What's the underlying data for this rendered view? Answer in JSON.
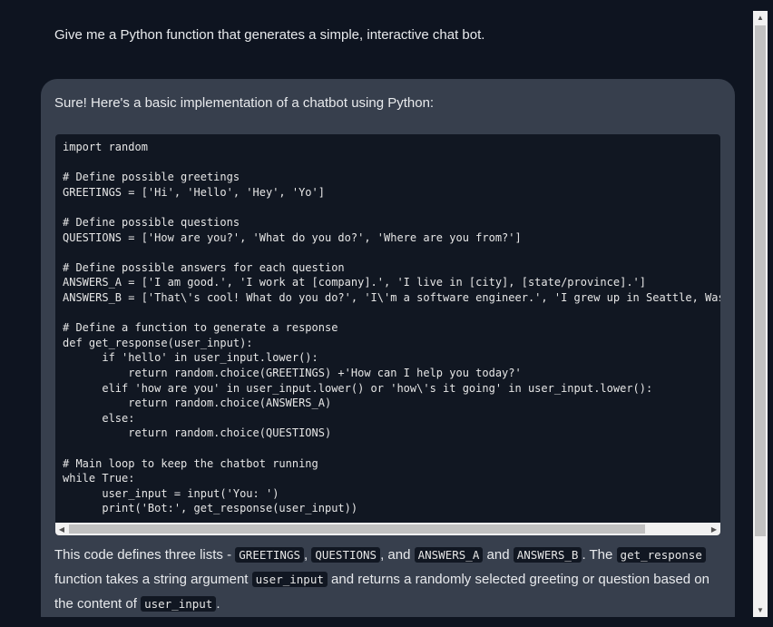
{
  "conversation": {
    "user_message": "Give me a Python function that generates a simple, interactive chat bot.",
    "assistant": {
      "intro": "Sure! Here's a basic implementation of a chatbot using Python:",
      "code_lines": [
        "import random",
        "",
        "# Define possible greetings",
        "GREETINGS = ['Hi', 'Hello', 'Hey', 'Yo']",
        "",
        "# Define possible questions",
        "QUESTIONS = ['How are you?', 'What do you do?', 'Where are you from?']",
        "",
        "# Define possible answers for each question",
        "ANSWERS_A = ['I am good.', 'I work at [company].', 'I live in [city], [state/province].']",
        "ANSWERS_B = ['That\\'s cool! What do you do?', 'I\\'m a software engineer.', 'I grew up in Seattle, Wash",
        "",
        "# Define a function to generate a response",
        "def get_response(user_input):",
        "      if 'hello' in user_input.lower():",
        "          return random.choice(GREETINGS) +'How can I help you today?'",
        "      elif 'how are you' in user_input.lower() or 'how\\'s it going' in user_input.lower():",
        "          return random.choice(ANSWERS_A)",
        "      else:",
        "          return random.choice(QUESTIONS)",
        "",
        "# Main loop to keep the chatbot running",
        "while True:",
        "      user_input = input('You: ')",
        "      print('Bot:', get_response(user_input))"
      ],
      "explanation": {
        "t1": "This code defines three lists - ",
        "c1": "GREETINGS",
        "t2": ", ",
        "c2": "QUESTIONS",
        "t3": ", and ",
        "c3": "ANSWERS_A",
        "t4": " and ",
        "c4": "ANSWERS_B",
        "t5": ". The ",
        "c5": "get_response",
        "t6": " function takes a string argument ",
        "c6": "user_input",
        "t7": " and returns a randomly selected greeting or question based on the content of ",
        "c7": "user_input",
        "t8": "."
      }
    }
  },
  "scrollbars": {
    "horizontal": {
      "left_arrow_icon": "◀",
      "right_arrow_icon": "▶"
    },
    "vertical": {
      "up_arrow_icon": "▲",
      "down_arrow_icon": "▼"
    }
  },
  "colors": {
    "page_bg": "#0e1420",
    "card_bg": "#373f4d",
    "code_bg": "#111722"
  }
}
